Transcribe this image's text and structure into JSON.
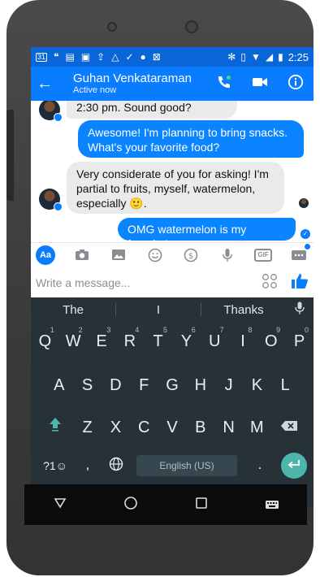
{
  "status_bar": {
    "time": "2:25",
    "left_icons": [
      "calendar-31-icon",
      "hangouts-icon",
      "message-icon",
      "image-icon",
      "upload-icon",
      "drive-icon",
      "check-icon",
      "chat-icon",
      "wifi-settings-icon"
    ],
    "calendar_day": "31",
    "right_icons": [
      "bluetooth-icon",
      "vibrate-icon",
      "wifi-icon",
      "signal-icon",
      "battery-icon"
    ]
  },
  "header": {
    "contact_name": "Guhan Venkataraman",
    "presence": "Active now"
  },
  "messages": [
    {
      "from": "them",
      "text": "2:30 pm. Sound good?"
    },
    {
      "from": "me",
      "text": "Awesome! I'm planning to bring snacks. What's your favorite food?"
    },
    {
      "from": "them",
      "text": "Very considerate of you for asking! I'm partial to fruits, myself, watermelon, especially 🙂."
    },
    {
      "from": "me",
      "text": "OMG watermelon is my favorite!"
    }
  ],
  "composer": {
    "aa_label": "Aa",
    "gif_label": "GIF",
    "placeholder": "Write a message...",
    "tool_icons": [
      "camera-icon",
      "gallery-icon",
      "emoji-icon",
      "dollar-icon",
      "mic-icon",
      "gif-icon",
      "more-icon"
    ]
  },
  "keyboard": {
    "suggestions": [
      "The",
      "I",
      "Thanks"
    ],
    "row1": [
      {
        "key": "Q",
        "hint": "1"
      },
      {
        "key": "W",
        "hint": "2"
      },
      {
        "key": "E",
        "hint": "3"
      },
      {
        "key": "R",
        "hint": "4"
      },
      {
        "key": "T",
        "hint": "5"
      },
      {
        "key": "Y",
        "hint": "6"
      },
      {
        "key": "U",
        "hint": "7"
      },
      {
        "key": "I",
        "hint": "8"
      },
      {
        "key": "O",
        "hint": "9"
      },
      {
        "key": "P",
        "hint": "0"
      }
    ],
    "row2": [
      "A",
      "S",
      "D",
      "F",
      "G",
      "H",
      "J",
      "K",
      "L"
    ],
    "row3": [
      "Z",
      "X",
      "C",
      "V",
      "B",
      "N",
      "M"
    ],
    "symbols_label": "?1☺",
    "comma": ",",
    "space_label": "English (US)",
    "period": "."
  },
  "colors": {
    "status_bar": "#0866d8",
    "app_bar": "#0a7cff",
    "outgoing_bubble": "#0a84ff",
    "incoming_bubble": "#e9eaec",
    "keyboard_bg": "#263238",
    "keyboard_accent": "#4db6ac"
  }
}
